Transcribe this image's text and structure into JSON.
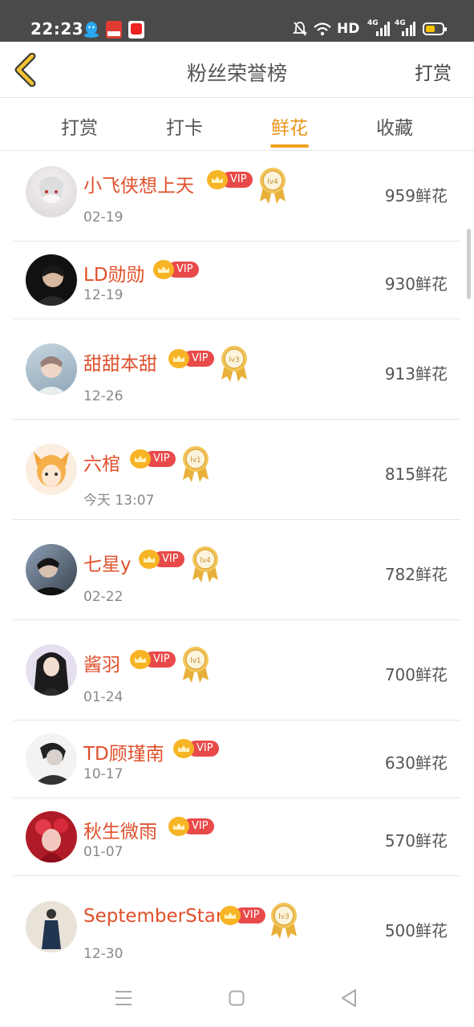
{
  "status_bar": {
    "time": "22:23",
    "network": "HD",
    "signal_1": "4G",
    "signal_2": "4G",
    "icons": [
      "qq-icon",
      "app-icon",
      "video-app-icon",
      "mute-icon",
      "wifi-icon",
      "battery-icon"
    ]
  },
  "header": {
    "back_icon": "chevron-left-icon",
    "title": "粉丝荣誉榜",
    "right_action": "打赏"
  },
  "tabs": [
    {
      "label": "打赏",
      "active": false
    },
    {
      "label": "打卡",
      "active": false
    },
    {
      "label": "鲜花",
      "active": true
    },
    {
      "label": "收藏",
      "active": false
    }
  ],
  "accent_color": "#f0a020",
  "name_color": "#e0502c",
  "fans": [
    {
      "name": "小飞侠想上天",
      "vip": "VIP",
      "level": "lv4",
      "date": "02-19",
      "count": "959鲜花"
    },
    {
      "name": "LD勋勋",
      "vip": "VIP",
      "level": "",
      "date": "12-19",
      "count": "930鲜花"
    },
    {
      "name": "甜甜本甜",
      "vip": "VIP",
      "level": "lv3",
      "date": "12-26",
      "count": "913鲜花"
    },
    {
      "name": "六棺",
      "vip": "VIP",
      "level": "lv1",
      "date": "今天 13:07",
      "count": "815鲜花"
    },
    {
      "name": "七星y",
      "vip": "VIP",
      "level": "lv4",
      "date": "02-22",
      "count": "782鲜花"
    },
    {
      "name": "酱羽",
      "vip": "VIP",
      "level": "lv1",
      "date": "01-24",
      "count": "700鲜花"
    },
    {
      "name": "TD顾瑾南",
      "vip": "VIP",
      "level": "",
      "date": "10-17",
      "count": "630鲜花"
    },
    {
      "name": "秋生微雨",
      "vip": "VIP",
      "level": "",
      "date": "01-07",
      "count": "570鲜花"
    },
    {
      "name": "SeptemberStar",
      "vip": "VIP",
      "level": "lv3",
      "date": "12-30",
      "count": "500鲜花"
    }
  ],
  "nav_bar": [
    "menu-icon",
    "home-icon",
    "back-triangle-icon"
  ]
}
